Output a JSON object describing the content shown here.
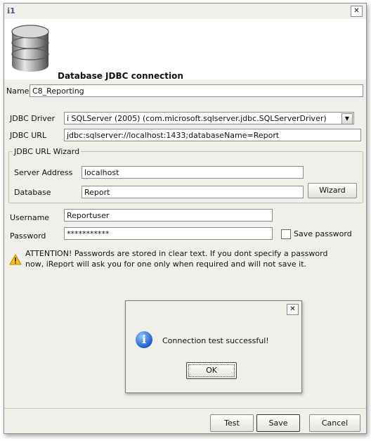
{
  "dialog": {
    "title_icon_label": "ℹ1",
    "header_title": "Database JDBC connection"
  },
  "name": {
    "label": "Name",
    "value": "C8_Reporting"
  },
  "jdbc_driver": {
    "label": "JDBC Driver",
    "value": "i SQLServer (2005) (com.microsoft.sqlserver.jdbc.SQLServerDriver)"
  },
  "jdbc_url": {
    "label": "JDBC URL",
    "value": "jdbc:sqlserver://localhost:1433;databaseName=Report"
  },
  "wizard": {
    "group_title": "JDBC URL Wizard",
    "server_label": "Server Address",
    "server_value": "localhost",
    "database_label": "Database",
    "database_value": "Report",
    "wizard_button": "Wizard"
  },
  "credentials": {
    "username_label": "Username",
    "username_value": "Reportuser",
    "password_label": "Password",
    "password_value": "***********",
    "save_password_label": "Save password",
    "save_password_checked": false
  },
  "warning": {
    "line1": "ATTENTION! Passwords are stored in clear text. If you dont specify a password",
    "line2": "now, iReport will ask you for one only when required and will not save it."
  },
  "footer": {
    "test": "Test",
    "save": "Save",
    "cancel": "Cancel"
  },
  "message_box": {
    "text": "Connection test successful!",
    "ok": "OK",
    "icon": "info-icon"
  },
  "close_glyph": "✕"
}
